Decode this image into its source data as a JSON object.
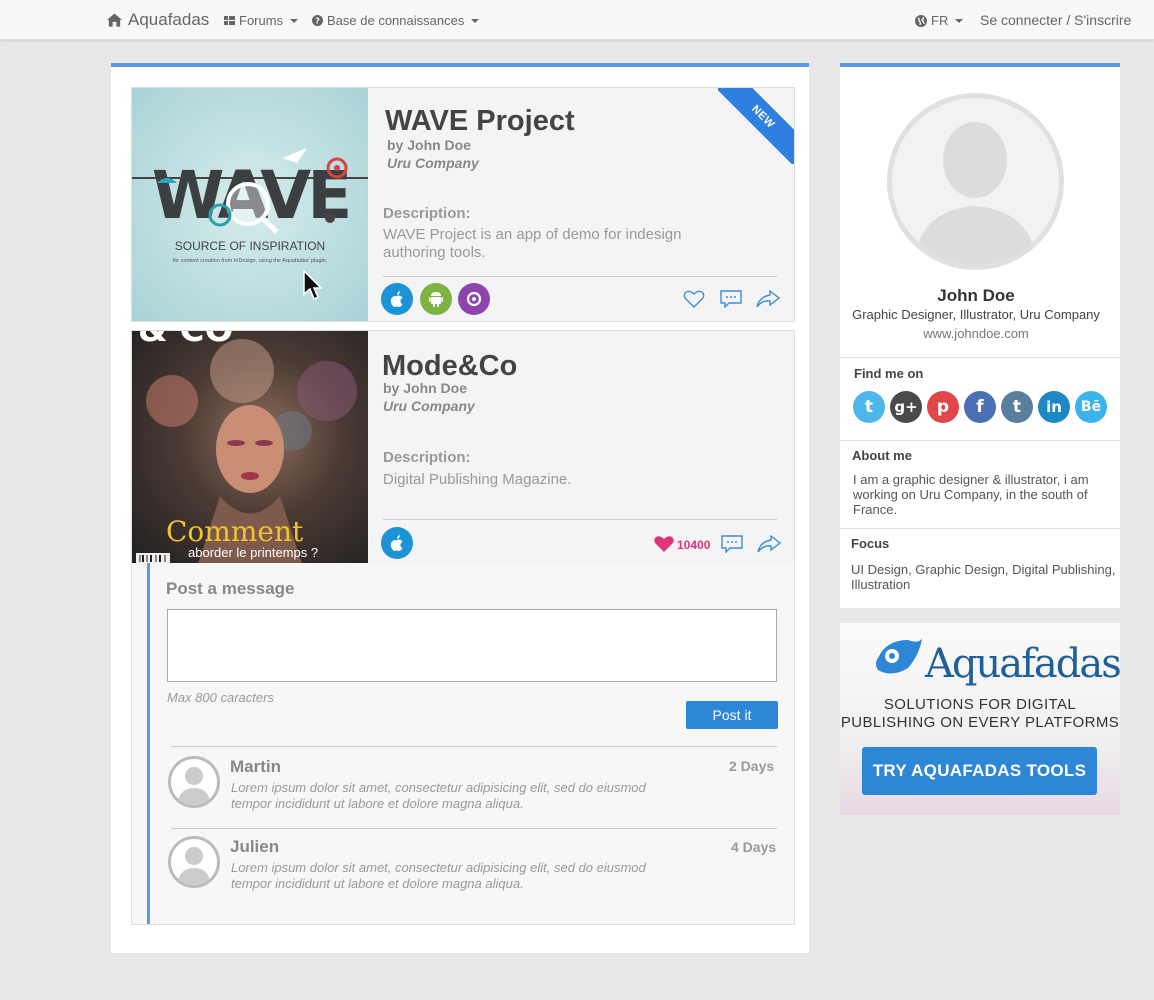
{
  "navbar": {
    "brand": "Aquafadas",
    "forums": "Forums",
    "knowledge_base": "Base de connaissances",
    "language": "FR",
    "login": "Se connecter / S'inscrire"
  },
  "projects": [
    {
      "title": "WAVE Project",
      "by": "by John Doe",
      "company": "Uru Company",
      "description_label": "Description:",
      "description": "WAVE Project is an app of demo for indesign authoring tools.",
      "badge": "NEW",
      "cover_title": "WAVE",
      "cover_subtitle": "SOURCE OF INSPIRATION",
      "cover_caption": "for content creation from InDesign, using the Aquafadas' plugin.",
      "platforms": [
        "apple-icon",
        "android-icon",
        "aquafadas-icon"
      ],
      "liked": false
    },
    {
      "title": "Mode&Co",
      "by": "by John Doe",
      "company": "Uru Company",
      "description_label": "Description:",
      "description": "Digital Publishing Magazine.",
      "cover_top": "& CO",
      "cover_title": "Comment",
      "cover_subtitle": "aborder le printemps ?",
      "platforms": [
        "apple-icon"
      ],
      "liked": true,
      "likes": "10400"
    }
  ],
  "message_form": {
    "heading": "Post a message",
    "placeholder": "",
    "hint": "Max 800 caracters",
    "submit": "Post it"
  },
  "comments": [
    {
      "author": "Martin",
      "time": "2 Days",
      "text": "Lorem ipsum dolor sit amet, consectetur adipisicing elit, sed do eiusmod tempor incididunt ut labore et dolore magna aliqua."
    },
    {
      "author": "Julien",
      "time": "4 Days",
      "text": "Lorem ipsum dolor sit amet, consectetur adipisicing elit, sed do eiusmod tempor incididunt ut labore et dolore magna aliqua."
    }
  ],
  "profile": {
    "name": "John Doe",
    "role": "Graphic Designer, Illustrator, Uru Company",
    "website": "www.johndoe.com",
    "find_me_heading": "Find me on",
    "social": [
      {
        "name": "twitter-icon",
        "glyph": "t",
        "color": "#4fb6ec"
      },
      {
        "name": "google-plus-icon",
        "glyph": "g+",
        "color": "#4a4a4a"
      },
      {
        "name": "pinterest-icon",
        "glyph": "p",
        "color": "#e1464a"
      },
      {
        "name": "facebook-icon",
        "glyph": "f",
        "color": "#4a6fb5"
      },
      {
        "name": "tumblr-icon",
        "glyph": "t",
        "color": "#5a7e9e"
      },
      {
        "name": "linkedin-icon",
        "glyph": "in",
        "color": "#1e87c6"
      },
      {
        "name": "behance-icon",
        "glyph": "Bē",
        "color": "#3bb3ec"
      }
    ],
    "about_heading": "About me",
    "about_text": "I am a graphic designer & illustrator, i am working on Uru Company, in the south of France.",
    "focus_heading": "Focus",
    "focus_text": "UI Design, Graphic Design, Digital Publishing, Illustration"
  },
  "ad": {
    "brand": "Aquafadas",
    "line1": "SOLUTIONS FOR DIGITAL",
    "line2": "PUBLISHING ON EVERY PLATFORMS",
    "cta": "TRY AQUAFADAS TOOLS"
  },
  "colors": {
    "accent": "#5b9ae8",
    "apple": "#1b93d6",
    "android": "#7cb342",
    "aquafadas": "#8e44ad",
    "like": "#e0357a",
    "action": "#3b8fd6",
    "cta": "#2e86d6"
  }
}
